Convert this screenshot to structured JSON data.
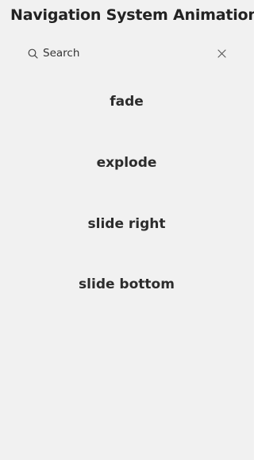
{
  "header": {
    "title": "Navigation System Animation"
  },
  "search": {
    "placeholder": "Search",
    "icon": "search-icon",
    "clear_icon": "close-icon"
  },
  "list": {
    "items": [
      {
        "label": "fade"
      },
      {
        "label": "explode"
      },
      {
        "label": "slide right"
      },
      {
        "label": "slide bottom"
      }
    ]
  },
  "colors": {
    "background": "#f1f1f1",
    "text": "#2c2c2c",
    "title": "#222222"
  }
}
